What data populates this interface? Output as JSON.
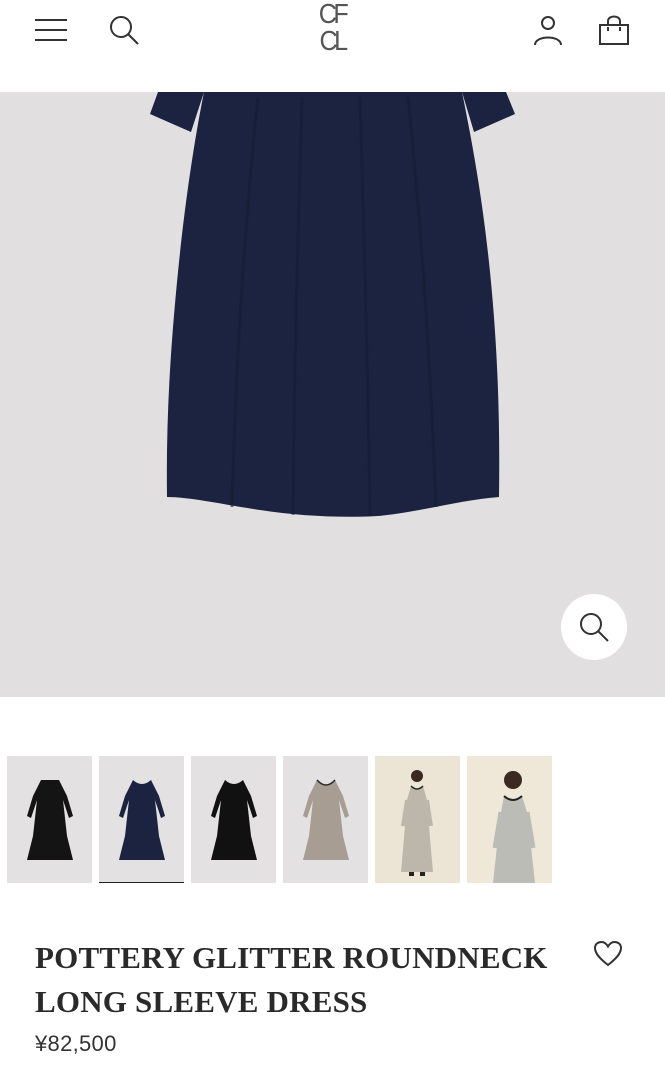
{
  "header": {
    "logo_top": "CF",
    "logo_bottom": "CL",
    "icons": [
      "hamburger-menu-icon",
      "search-icon",
      "account-icon",
      "shopping-bag-icon"
    ]
  },
  "gallery": {
    "zoom_icon": "magnifier-icon",
    "thumbnails": [
      {
        "color": "black",
        "kind": "flat"
      },
      {
        "color": "navy",
        "kind": "flat",
        "selected": true
      },
      {
        "color": "black",
        "kind": "flat"
      },
      {
        "color": "beige",
        "kind": "flat"
      },
      {
        "color": "beige",
        "kind": "model"
      },
      {
        "color": "light-grey",
        "kind": "model"
      }
    ]
  },
  "product": {
    "title_line1": "POTTERY GLITTER ROUNDNECK",
    "title_line2": "LONG SLEEVE DRESS",
    "price": "¥82,500",
    "wishlist_icon": "heart-outline-icon"
  },
  "colors": {
    "hero_background": "#e1dfe0",
    "dress_navy": "#1b2340",
    "text": "#2a2a2a"
  }
}
